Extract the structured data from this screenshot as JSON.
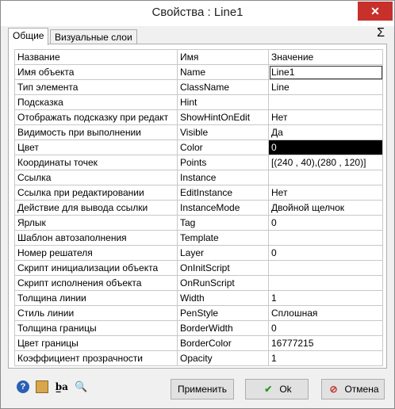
{
  "window": {
    "title": "Свойства : Line1",
    "close_glyph": "✕"
  },
  "tabs": [
    {
      "label": "Общие",
      "active": true
    },
    {
      "label": "Визуальные слои",
      "active": false
    }
  ],
  "sigma_glyph": "Σ",
  "grid": {
    "headers": [
      "Название",
      "Имя",
      "Значение"
    ],
    "rows": [
      {
        "label": "Имя объекта",
        "name": "Name",
        "value": "Line1"
      },
      {
        "label": "Тип элемента",
        "name": "ClassName",
        "value": "Line"
      },
      {
        "label": "Подсказка",
        "name": "Hint",
        "value": ""
      },
      {
        "label": "Отображать подсказку при редакт",
        "name": "ShowHintOnEdit",
        "value": "Нет"
      },
      {
        "label": "Видимость при выполнении",
        "name": "Visible",
        "value": "Да"
      },
      {
        "label": "Цвет",
        "name": "Color",
        "value": "0"
      },
      {
        "label": "Координаты точек",
        "name": "Points",
        "value": "[(240 , 40),(280 , 120)]"
      },
      {
        "label": "Ссылка",
        "name": "Instance",
        "value": ""
      },
      {
        "label": "Ссылка при редактировании",
        "name": "EditInstance",
        "value": "Нет"
      },
      {
        "label": "Действие для вывода ссылки",
        "name": "InstanceMode",
        "value": "Двойной щелчок"
      },
      {
        "label": "Ярлык",
        "name": "Tag",
        "value": "0"
      },
      {
        "label": "Шаблон автозаполнения",
        "name": "Template",
        "value": ""
      },
      {
        "label": "Номер решателя",
        "name": "Layer",
        "value": "0"
      },
      {
        "label": "Скрипт инициализации объекта",
        "name": "OnInitScript",
        "value": ""
      },
      {
        "label": "Скрипт исполнения объекта",
        "name": "OnRunScript",
        "value": ""
      },
      {
        "label": "Толщина линии",
        "name": "Width",
        "value": "1"
      },
      {
        "label": "Стиль линии",
        "name": "PenStyle",
        "value": "Сплошная"
      },
      {
        "label": "Толщина границы",
        "name": "BorderWidth",
        "value": "0"
      },
      {
        "label": "Цвет границы",
        "name": "BorderColor",
        "value": "16777215"
      },
      {
        "label": "Коэффициент прозрачности",
        "name": "Opacity",
        "value": "1"
      }
    ]
  },
  "footer": {
    "icons": {
      "help": "?",
      "ba": "b̲a",
      "search": "🔍"
    },
    "apply_label": "Применить",
    "ok_label": "Ok",
    "ok_glyph": "✔",
    "cancel_label": "Отмена",
    "cancel_glyph": "⊘",
    "colors": {
      "ok_check": "#2a9a2a",
      "cancel": "#c7302b",
      "color_swatch": "#000000"
    }
  }
}
